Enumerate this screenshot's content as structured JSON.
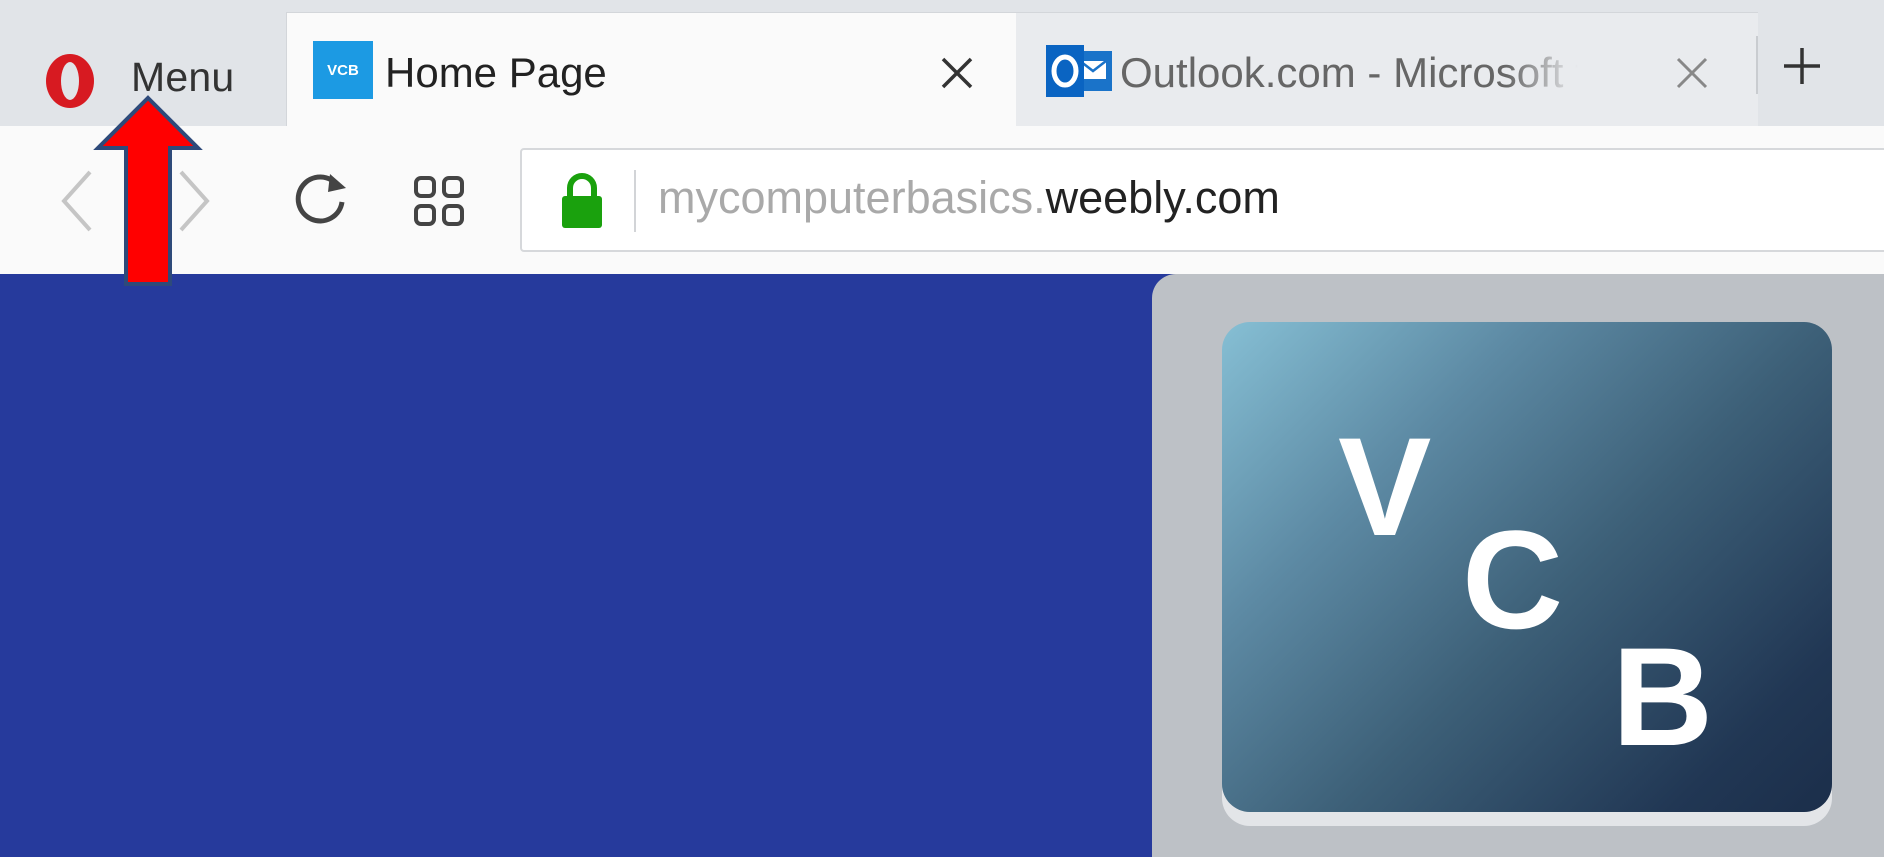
{
  "browser": {
    "menu_label": "Menu",
    "tabs": [
      {
        "favicon_text": "VCB",
        "title": "Home Page",
        "active": true
      },
      {
        "favicon_text": "O",
        "title": "Outlook.com - Microsoft f",
        "active": false
      }
    ],
    "address_bar": {
      "subdomain": "mycomputerbasics.",
      "domain": "weebly.com"
    }
  },
  "page": {
    "logo_letters": [
      "V",
      "C",
      "B"
    ]
  },
  "colors": {
    "page_background": "#263a9c",
    "annotation_arrow": "#ff0000",
    "lock": "#1aa10d",
    "opera_red": "#d71a21"
  }
}
